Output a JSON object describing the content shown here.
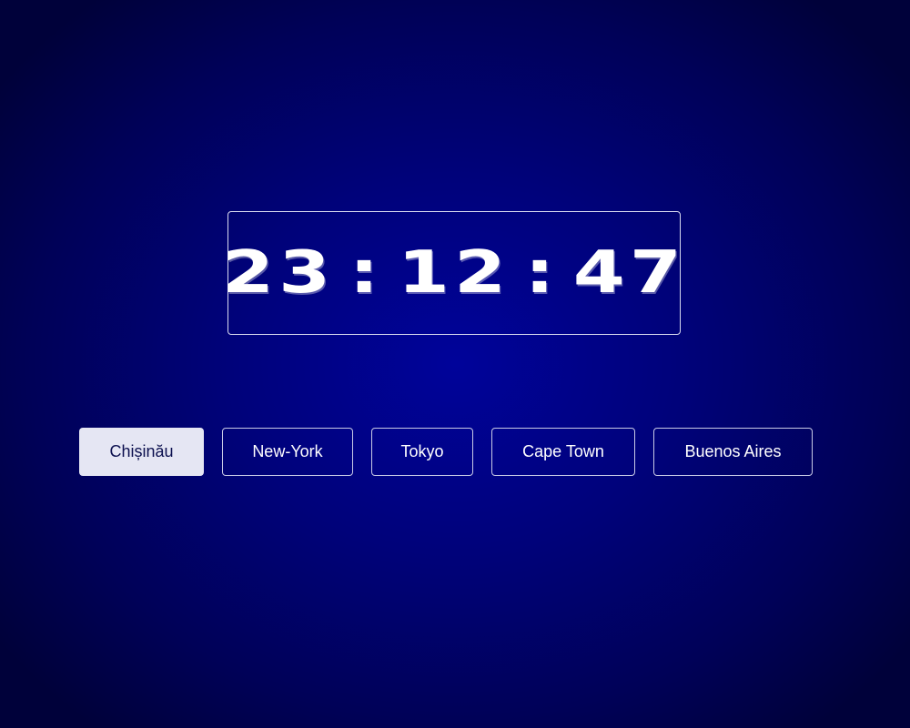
{
  "clock": {
    "hours": "23",
    "minutes": "12",
    "seconds": "47",
    "separator": ":"
  },
  "cities": [
    {
      "label": "Chișinău",
      "selected": true
    },
    {
      "label": "New-York",
      "selected": false
    },
    {
      "label": "Tokyo",
      "selected": false
    },
    {
      "label": "Cape Town",
      "selected": false
    },
    {
      "label": "Buenos Aires",
      "selected": false
    }
  ],
  "colors": {
    "background": "#00027a",
    "selected_button_bg": "#e5e6f3",
    "selected_button_text": "#0b0f4e",
    "text": "#ffffff"
  }
}
